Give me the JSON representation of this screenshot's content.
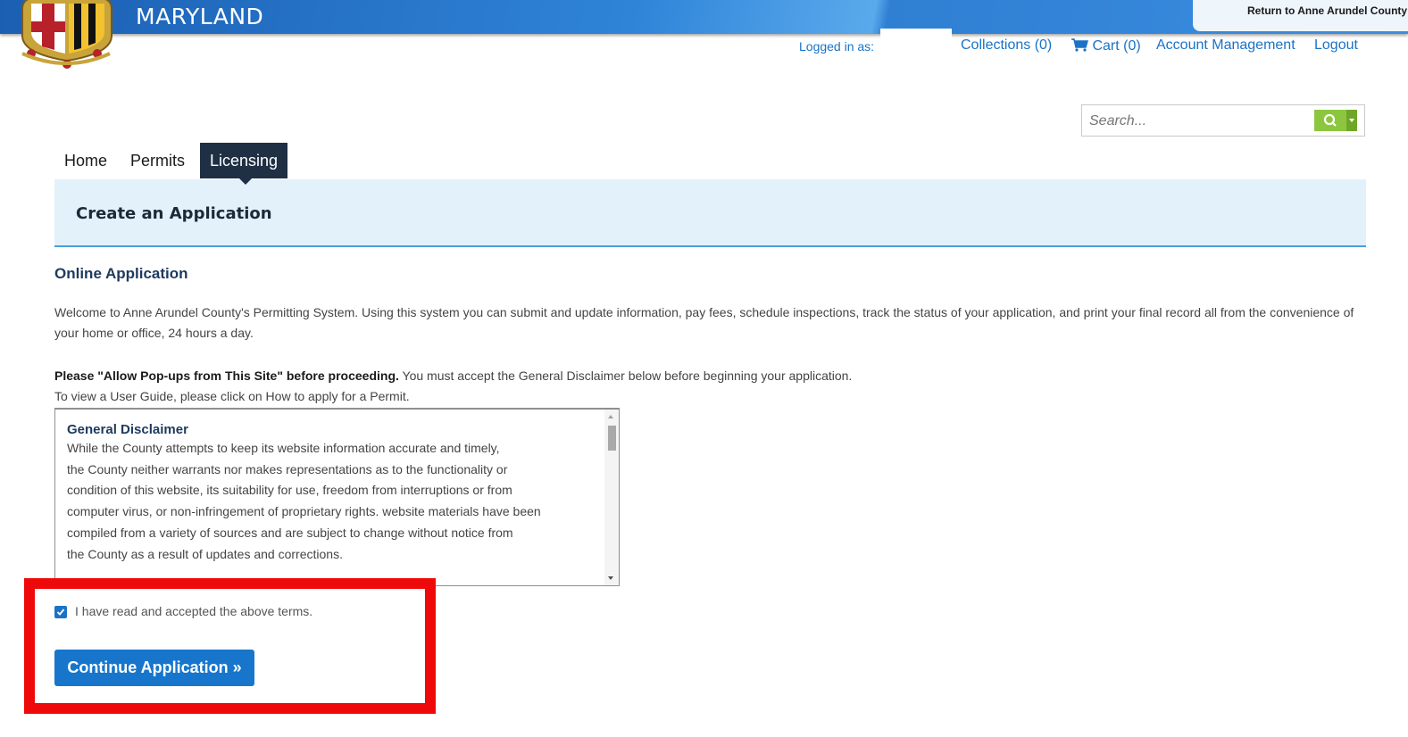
{
  "header": {
    "brand": "MARYLAND",
    "return_link": "Return to Anne Arundel County",
    "logged_in_label": "Logged in as:",
    "collections": "Collections (0)",
    "cart": "Cart (0)",
    "account": "Account Management",
    "logout": "Logout"
  },
  "search": {
    "placeholder": "Search..."
  },
  "tabs": [
    {
      "label": "Home"
    },
    {
      "label": "Permits"
    },
    {
      "label": "Licensing",
      "active": true
    }
  ],
  "page": {
    "title": "Create an Application",
    "section_title": "Online Application",
    "welcome": "Welcome to Anne Arundel County's Permitting System. Using this system you can submit and update information, pay fees, schedule inspections, track the status of your application, and print your final record all from the convenience of your home or office, 24 hours a day.",
    "popup_bold": "Please \"Allow Pop-ups from This Site\" before proceeding.",
    "popup_rest": " You must accept the General Disclaimer below before beginning your application.",
    "guide": "To view a User Guide, please click on How to apply for a Permit."
  },
  "disclaimer": {
    "title": "General Disclaimer",
    "lines": [
      "While the County attempts to keep its website information accurate and timely,",
      "the County neither warrants nor makes representations as to the functionality or",
      "condition of this website, its suitability for use, freedom from interruptions or from",
      "computer virus, or non-infringement of proprietary rights. website materials have been",
      "compiled from a variety of sources and are subject to change without notice from",
      "the County as a result of updates and corrections."
    ]
  },
  "accept": {
    "label": "I have read and accepted the above terms.",
    "checked": true
  },
  "continue_label": "Continue Application »",
  "colors": {
    "accent": "#1776cc",
    "highlight": "#ee0a0a",
    "tab_active": "#1f2f44",
    "search_green": "#8cc63f"
  }
}
